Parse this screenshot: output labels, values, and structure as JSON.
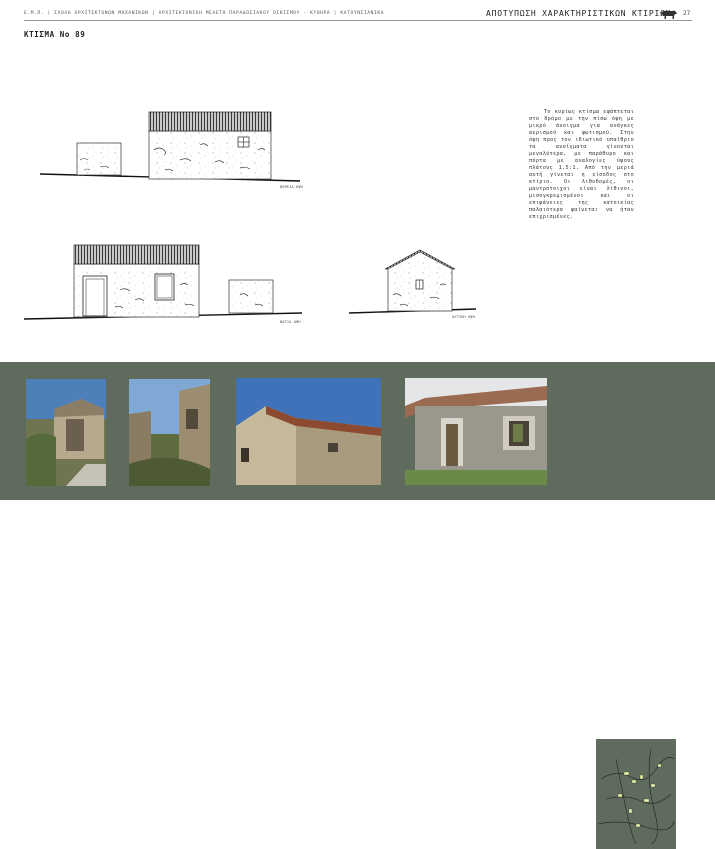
{
  "header": {
    "left_text": "Ε.Μ.Π. | ΣΧΟΛΗ ΑΡΧΙΤΕΚΤΟΝΩΝ ΜΗΧΑΝΙΚΩΝ | ΑΡΧΙΤΕΚΤΟΝΙΚΗ ΜΕΛΕΤΗ ΠΑΡΑΔΟΣΙΑΚΟΥ ΟΙΚΙΣΜΟΥ - ΚΥΘΗΡΑ | ΚΑΤΟΥΝΣΙΑΝΙΚΑ",
    "title": "ΑΠΟΤΥΠΩΣΗ ΧΑΡΑΚΤΗΡΙΣΤΙΚΩΝ  ΚΤΙΡΙΩΝ",
    "page_number": "27",
    "logo_icon": "animal-silhouette-icon"
  },
  "building_title": "ΚΤΙΣΜΑ Νο 89",
  "views": {
    "north_label": "ΒΟΡΕΙΑ ΟΨΗ",
    "south_label": "ΝΟΤΙΑ ΟΨΗ",
    "west_label": "ΔΥΤΙΚΗ ΟΨΗ"
  },
  "description": "Το κυρίως κτίσμα εφάπτεται στο δρόμο με την πίσω όψη με μικρό άνοιγμα για ανάγκες αερισμού και φωτισμού. Στην όψη προς τον ιδιωτικό υπαίθριο τα ανοίγματα γίνονται μεγαλύτερα, με παράθυρο και πόρτα με αναλογίες ύψους πλάτους 1,5:1. Από την μεριά αυτή γίνεται η είσοδος στο κτίριο. Οι λιθοδομές, οι μαντρότοιχοι είναι λίθινοι, μισογκρεμισμένοι και οι επιφάνειες της κατοικίας παλαιότερα φαίνεται να ήταν επιχρισμένες.",
  "colors": {
    "photo_band": "#5f6b5c",
    "map_highlight": "#e9f4a8"
  }
}
